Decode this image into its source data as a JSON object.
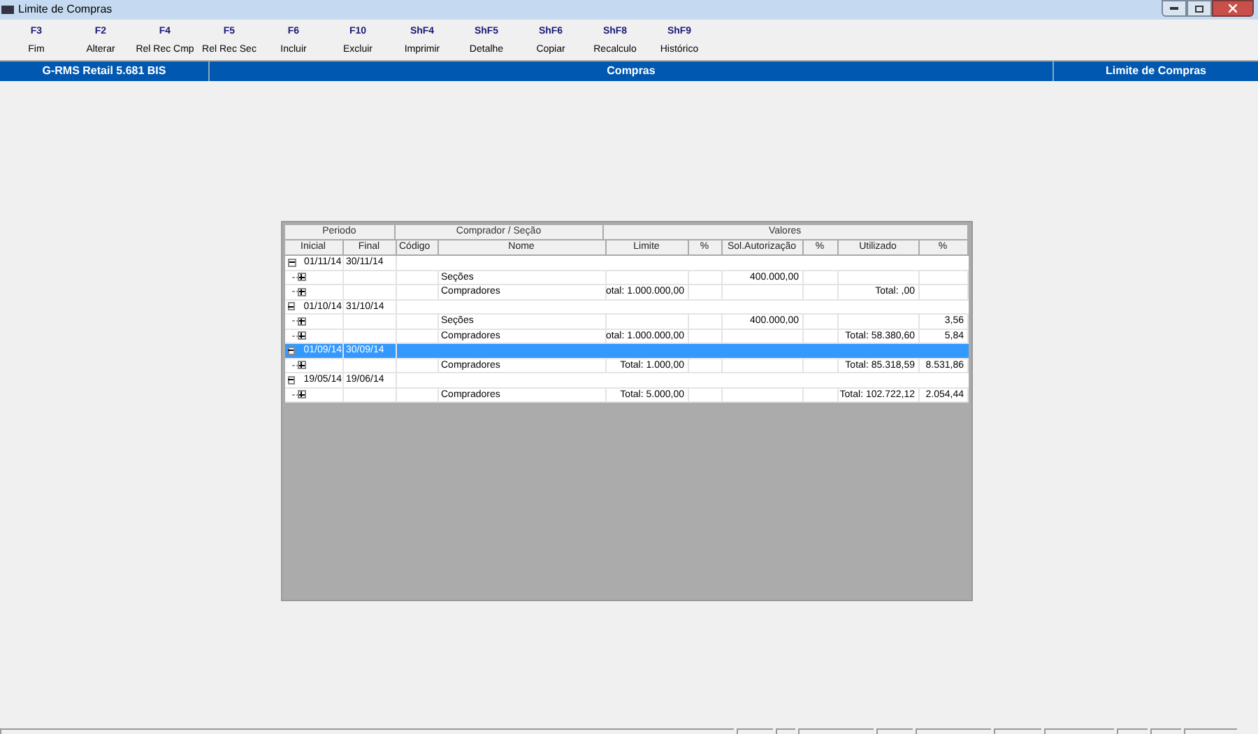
{
  "window": {
    "title": "Limite de Compras"
  },
  "toolbar": [
    {
      "key": "F3",
      "label": "Fim"
    },
    {
      "key": "F2",
      "label": "Alterar"
    },
    {
      "key": "F4",
      "label": "Rel Rec Cmp"
    },
    {
      "key": "F5",
      "label": "Rel Rec Sec"
    },
    {
      "key": "F6",
      "label": "Incluir"
    },
    {
      "key": "F10",
      "label": "Excluir"
    },
    {
      "key": "ShF4",
      "label": "Imprimir"
    },
    {
      "key": "ShF5",
      "label": "Detalhe"
    },
    {
      "key": "ShF6",
      "label": "Copiar"
    },
    {
      "key": "ShF8",
      "label": "Recalculo"
    },
    {
      "key": "ShF9",
      "label": "Histórico"
    }
  ],
  "header_bar": {
    "product": "G-RMS Retail 5.681 BIS",
    "module": "Compras",
    "screen": "Limite de Compras"
  },
  "table": {
    "groups": [
      "Periodo",
      "Comprador / Seção",
      "Valores"
    ],
    "columns": [
      "Inicial",
      "Final",
      "Código",
      "Nome",
      "Limite",
      "%",
      "Sol.Autorização",
      "%",
      "Utilizado",
      "%"
    ],
    "rows": [
      {
        "inicial": "01/11/14",
        "final": "30/11/14",
        "expanded": true,
        "selected": false,
        "children": [
          {
            "nome": "Seções",
            "sol": "400.000,00"
          },
          {
            "nome": "Compradores",
            "limite": "otal: 1.000.000,00",
            "utilizado": "Total: ,00"
          }
        ]
      },
      {
        "inicial": "01/10/14",
        "final": "31/10/14",
        "expanded": true,
        "selected": false,
        "children": [
          {
            "nome": "Seções",
            "sol": "400.000,00",
            "pct_utilizado": "3,56"
          },
          {
            "nome": "Compradores",
            "limite": "otal: 1.000.000,00",
            "utilizado": "Total: 58.380,60",
            "pct_utilizado": "5,84"
          }
        ]
      },
      {
        "inicial": "01/09/14",
        "final": "30/09/14",
        "expanded": true,
        "selected": true,
        "children": [
          {
            "nome": "Compradores",
            "limite": "Total: 1.000,00",
            "utilizado": "Total: 85.318,59",
            "pct_utilizado": "8.531,86"
          }
        ]
      },
      {
        "inicial": "19/05/14",
        "final": "19/06/14",
        "expanded": true,
        "selected": false,
        "children": [
          {
            "nome": "Compradores",
            "limite": "Total: 5.000,00",
            "utilizado": "Total: 102.722,12",
            "pct_utilizado": "2.054,44"
          }
        ]
      }
    ]
  }
}
